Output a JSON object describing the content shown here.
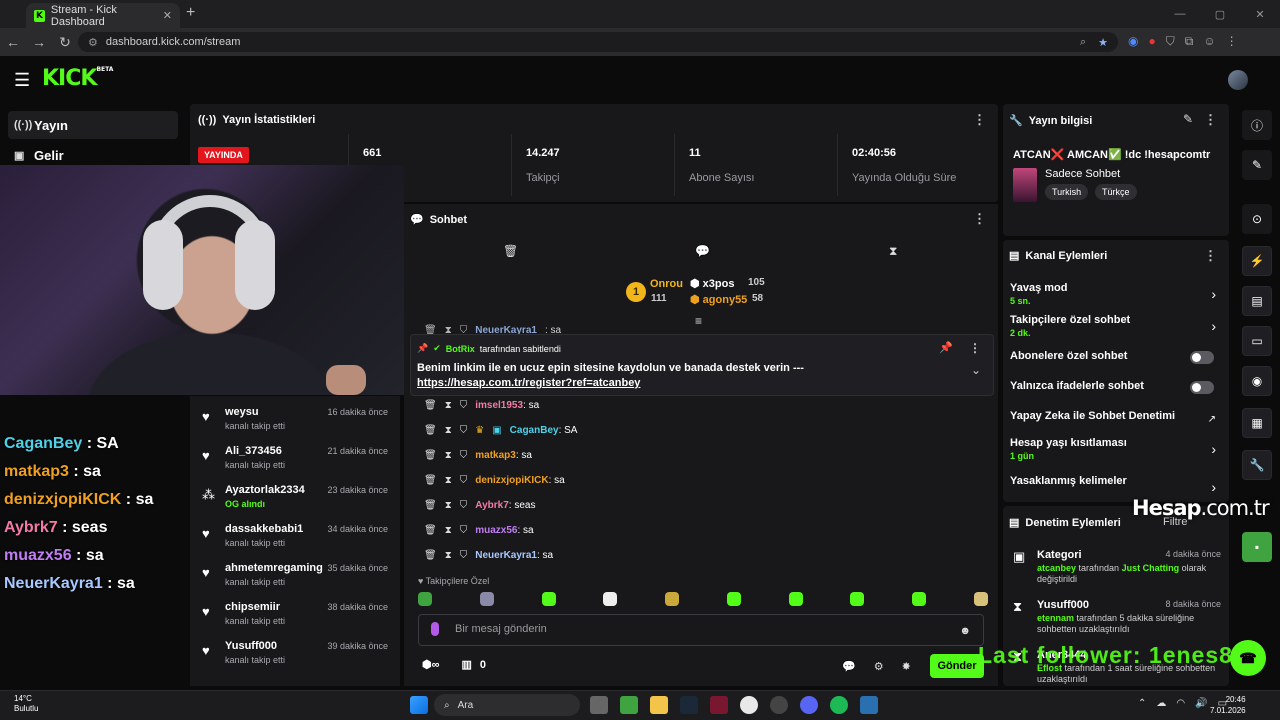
{
  "browser": {
    "tab_title": "Stream - Kick Dashboard",
    "url": "dashboard.kick.com/stream",
    "tab_close": "✕",
    "new_tab": "+",
    "window_buttons": [
      "—",
      "▢",
      "✕"
    ]
  },
  "app": {
    "logo": "KICK",
    "logo_badge": "BETA"
  },
  "left_nav": [
    {
      "label": "Yayın",
      "icon": "broadcast-icon"
    },
    {
      "label": "Gelir",
      "icon": "revenue-icon"
    }
  ],
  "stream_stats": {
    "title": "Yayın İstatistikleri",
    "live_badge": "YAYINDA",
    "viewers": "661",
    "followers": "14.247",
    "followers_label": "Takipçi",
    "subscribers": "11",
    "subscribers_label": "Abone Sayısı",
    "uptime": "02:40:56",
    "uptime_label": "Yayında Olduğu Süre"
  },
  "overlay_chat": [
    {
      "user": "CaganBey",
      "msg": " : SA",
      "color": "#4fd1e8"
    },
    {
      "user": "matkap3",
      "msg": " : sa",
      "color": "#f0a020"
    },
    {
      "user": "denizxjopiKICK",
      "msg": " : sa",
      "color": "#f0a020"
    },
    {
      "user": "Aybrk7",
      "msg": " : seas",
      "color": "#f47ba7"
    },
    {
      "user": "muazx56",
      "msg": " : sa",
      "color": "#c07ef2"
    },
    {
      "user": "NeuerKayra1",
      "msg": " : sa",
      "color": "#a8c8ff"
    }
  ],
  "followers": [
    {
      "name": "weysu",
      "sub": "kanalı takip etti",
      "time": "16 dakika önce",
      "icon": "heart-icon"
    },
    {
      "name": "Ali_373456",
      "sub": "kanalı takip etti",
      "time": "21 dakika önce",
      "icon": "heart-icon"
    },
    {
      "name": "Ayaztorlak2334",
      "sub": "OG alındı",
      "time": "23 dakika önce",
      "icon": "og-icon"
    },
    {
      "name": "dassakkebabi1",
      "sub": "kanalı takip etti",
      "time": "34 dakika önce",
      "icon": "heart-icon"
    },
    {
      "name": "ahmetemregaming",
      "sub": "kanalı takip etti",
      "time": "35 dakika önce",
      "icon": "heart-icon"
    },
    {
      "name": "chipsemiir",
      "sub": "kanalı takip etti",
      "time": "38 dakika önce",
      "icon": "heart-icon"
    },
    {
      "name": "Yusuff000",
      "sub": "kanalı takip etti",
      "time": "39 dakika önce",
      "icon": "heart-icon"
    }
  ],
  "chat": {
    "title": "Sohbet",
    "leaderboard": {
      "first": {
        "name": "Onrou",
        "value": "111",
        "rank": "1"
      },
      "second": {
        "name": "x3pos",
        "value": "105"
      },
      "third": {
        "name": "agony55",
        "value": "58"
      }
    },
    "partial_line": {
      "user": "NeuerKayra1",
      "msg": ": sa"
    },
    "pinned": {
      "by": "BotRix",
      "by_suffix": "tarafından sabitlendi",
      "text": "Benim linkim ile en ucuz epin sitesine kaydolun ve banada destek verin --- ",
      "link": "https://hesap.com.tr/register?ref=atcanbey"
    },
    "messages": [
      {
        "user": "imsel1953",
        "msg": ": sa",
        "color": "#f47ba7"
      },
      {
        "user": "CaganBey",
        "msg": ": SA",
        "color": "#4fd1e8"
      },
      {
        "user": "matkap3",
        "msg": ": sa",
        "color": "#f0a020"
      },
      {
        "user": "denizxjopiKICK",
        "msg": ": sa",
        "color": "#f0a020"
      },
      {
        "user": "Aybrk7",
        "msg": ": seas",
        "color": "#f47ba7"
      },
      {
        "user": "muazx56",
        "msg": ": sa",
        "color": "#c07ef2"
      },
      {
        "user": "NeuerKayra1",
        "msg": ": sa",
        "color": "#a8c8ff"
      }
    ],
    "followers_only_label": "♥ Takipçilere Özel",
    "input_placeholder": "Bir mesaj gönderin",
    "kicks_count": "0",
    "send_label": "Gönder"
  },
  "stream_info": {
    "title": "Yayın bilgisi",
    "stream_title": "ATCAN❌ AMCAN✅ !dc !hesapcomtr",
    "category": "Sadece Sohbet",
    "tags": [
      "Turkish",
      "Türkçe"
    ]
  },
  "channel_actions": {
    "title": "Kanal Eylemleri",
    "items": [
      {
        "label": "Yavaş mod",
        "value": "5 sn.",
        "control": "chevron"
      },
      {
        "label": "Takipçilere özel sohbet",
        "value": "2 dk.",
        "control": "chevron"
      },
      {
        "label": "Abonelere özel sohbet",
        "value": "",
        "control": "toggle"
      },
      {
        "label": "Yalnızca ifadelerle sohbet",
        "value": "",
        "control": "toggle"
      },
      {
        "label": "Yapay Zeka ile Sohbet Denetimi",
        "value": "",
        "control": "external"
      },
      {
        "label": "Hesap yaşı kısıtlaması",
        "value": "1 gün",
        "control": "chevron"
      },
      {
        "label": "Yasaklanmış kelimeler",
        "value": "",
        "control": "chevron"
      }
    ]
  },
  "mod_log": {
    "title": "Denetim Eylemleri",
    "filter_label": "Filtre",
    "items": [
      {
        "title": "Kategori",
        "time": "4 dakika önce",
        "actor": "atcanbey",
        "mid": " tarafından ",
        "target": "Just Chatting",
        "rest": " olarak değiştirildi"
      },
      {
        "title": "Yusuff000",
        "time": "8 dakika önce",
        "actor": "etennam",
        "mid": " tarafından 5 dakika süreliğine sohbetten uzaklaştırıldı",
        "target": "",
        "rest": ""
      },
      {
        "title": "Aner3444",
        "time": "",
        "actor": "Eflost",
        "mid": " tarafından 1 saat süreliğine sohbetten uzaklaştırıldı",
        "target": "",
        "rest": ""
      }
    ]
  },
  "overlays": {
    "brand": "Hesap",
    "brand_domain": ".com.tr",
    "last_follower": "Last follower: 1enes8"
  },
  "taskbar": {
    "temp": "14°C",
    "weather": "Bulutlu",
    "search": "Ara",
    "time": "20:46",
    "date": "7.01.2026"
  },
  "colors": {
    "accent": "#53fc18",
    "live": "#e2161c",
    "panel": "#18181b"
  }
}
